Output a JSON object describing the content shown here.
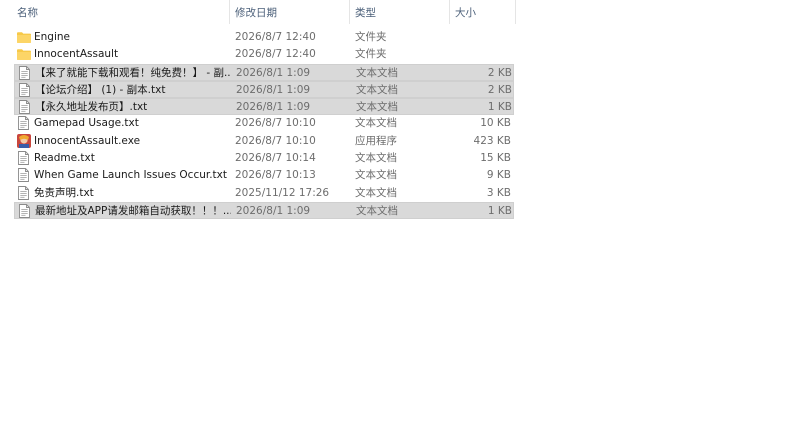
{
  "columns": {
    "name": "名称",
    "date": "修改日期",
    "type": "类型",
    "size": "大小"
  },
  "sort_indicator": "^",
  "files": [
    {
      "name": "Engine",
      "date": "2026/8/7 12:40",
      "type": "文件夹",
      "size": "",
      "icon": "folder-icon",
      "selected": false
    },
    {
      "name": "InnocentAssault",
      "date": "2026/8/7 12:40",
      "type": "文件夹",
      "size": "",
      "icon": "folder-icon",
      "selected": false
    },
    {
      "name": "【来了就能下载和观看！纯免费！】 - 副...",
      "date": "2026/8/1 1:09",
      "type": "文本文档",
      "size": "2 KB",
      "icon": "text-file-icon",
      "selected": true
    },
    {
      "name": "【论坛介绍】 (1) - 副本.txt",
      "date": "2026/8/1 1:09",
      "type": "文本文档",
      "size": "2 KB",
      "icon": "text-file-icon",
      "selected": true
    },
    {
      "name": "【永久地址发布页】.txt",
      "date": "2026/8/1 1:09",
      "type": "文本文档",
      "size": "1 KB",
      "icon": "text-file-icon",
      "selected": true
    },
    {
      "name": "Gamepad Usage.txt",
      "date": "2026/8/7 10:10",
      "type": "文本文档",
      "size": "10 KB",
      "icon": "text-file-icon",
      "selected": false
    },
    {
      "name": "InnocentAssault.exe",
      "date": "2026/8/7 10:10",
      "type": "应用程序",
      "size": "423 KB",
      "icon": "app-icon",
      "selected": false
    },
    {
      "name": "Readme.txt",
      "date": "2026/8/7 10:14",
      "type": "文本文档",
      "size": "15 KB",
      "icon": "text-file-icon",
      "selected": false
    },
    {
      "name": "When Game Launch Issues Occur.txt",
      "date": "2026/8/7 10:13",
      "type": "文本文档",
      "size": "9 KB",
      "icon": "text-file-icon",
      "selected": false
    },
    {
      "name": "免责声明.txt",
      "date": "2025/11/12 17:26",
      "type": "文本文档",
      "size": "3 KB",
      "icon": "text-file-icon",
      "selected": false
    },
    {
      "name": "最新地址及APP请发邮箱自动获取！！！...",
      "date": "2026/8/1 1:09",
      "type": "文本文档",
      "size": "1 KB",
      "icon": "text-file-icon",
      "selected": true
    }
  ],
  "colors": {
    "header_text": "#4c607a",
    "selected_bg": "#d9d9d9",
    "folder": "#f7c948",
    "secondary_text": "#6d6d6d"
  }
}
